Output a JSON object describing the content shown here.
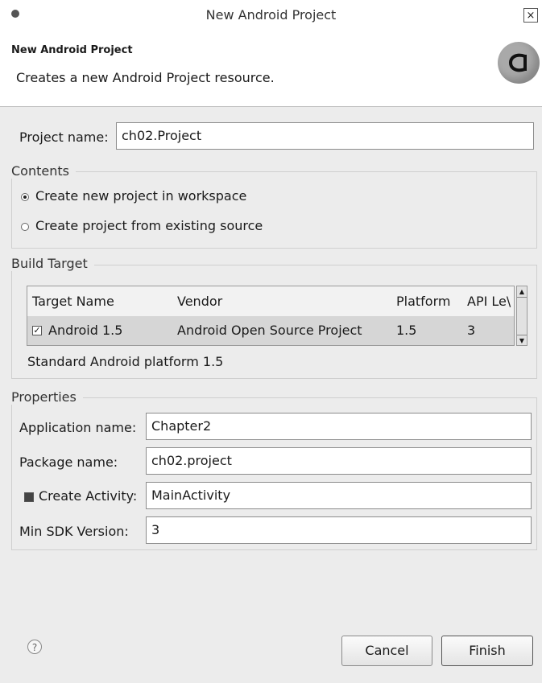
{
  "window": {
    "title": "New Android Project",
    "close_glyph": "×"
  },
  "header": {
    "title": "New Android Project",
    "description": "Creates a new Android Project resource.",
    "logo_icon": "android-wizard-logo-icon"
  },
  "project_name": {
    "label": "Project name:",
    "value": "ch02.Project"
  },
  "contents": {
    "title": "Contents",
    "options": [
      {
        "label": "Create new project in workspace",
        "selected": true
      },
      {
        "label": "Create project from existing source",
        "selected": false
      }
    ]
  },
  "build_target": {
    "title": "Build Target",
    "columns": [
      "Target Name",
      "Vendor",
      "Platform",
      "API Le\\"
    ],
    "rows": [
      {
        "checked": true,
        "target_name": "Android 1.5",
        "vendor": "Android Open Source Project",
        "platform": "1.5",
        "api_level": "3"
      }
    ],
    "description": "Standard Android platform 1.5"
  },
  "properties": {
    "title": "Properties",
    "application_name": {
      "label": "Application name:",
      "value": "Chapter2"
    },
    "package_name": {
      "label": "Package name:",
      "value": "ch02.project"
    },
    "create_activity": {
      "label": "Create Activity:",
      "value": "MainActivity",
      "checked": true
    },
    "min_sdk": {
      "label": "Min SDK Version:",
      "value": "3"
    }
  },
  "footer": {
    "help_glyph": "?",
    "cancel_label": "Cancel",
    "finish_label": "Finish"
  },
  "colors": {
    "panel_bg": "#ececec",
    "selected_row_bg": "#d6d6d6"
  }
}
